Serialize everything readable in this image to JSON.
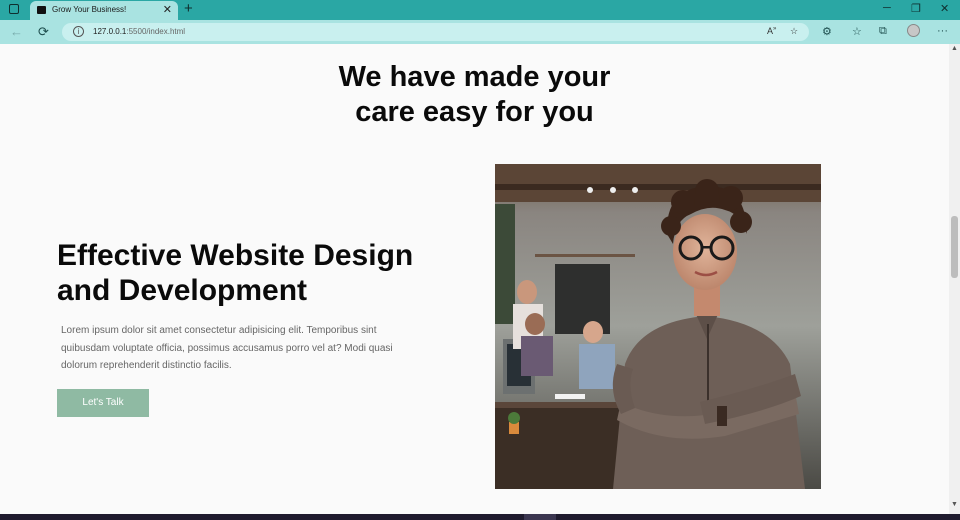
{
  "browser": {
    "tab_title": "Grow Your Business!",
    "tab_close": "✕",
    "new_tab": "+",
    "url_host": "127.0.0.1",
    "url_path": ":5500/index.html",
    "window_controls": {
      "minimize": "─",
      "restore": "❐",
      "close": "✕"
    },
    "icons": [
      "tab-actions-icon",
      "back-icon",
      "refresh-icon",
      "info-icon",
      "read-aloud-icon",
      "favorite-add-icon",
      "extensions-icon",
      "favorites-icon",
      "collections-icon",
      "profile-icon",
      "more-icon"
    ]
  },
  "page": {
    "heading_line1": "We have made your",
    "heading_line2": "care easy for you",
    "subheading_line1": "Effective Website Design",
    "subheading_line2": "and Development",
    "body": "Lorem ipsum dolor sit amet consectetur adipisicing elit. Temporibus sint quibusdam voluptate officia, possimus accusamus porro vel at? Modi quasi dolorum reprehenderit distinctio facilis.",
    "cta_label": "Let's Talk",
    "photo_subject": "woman-with-glasses-arms-crossed-in-office"
  },
  "colors": {
    "tabbar": "#2aa7a4",
    "toolbar": "#a9e3e1",
    "cta": "#8fbaa3",
    "page_bg": "#fafafa"
  }
}
